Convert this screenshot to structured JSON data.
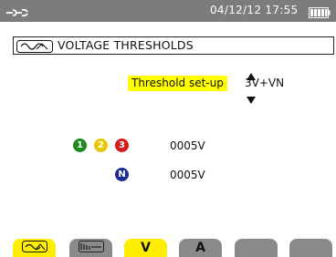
{
  "status_bar": {
    "datetime": "04/12/12 17:55",
    "icons": [
      "wrench-icon",
      "battery-icon"
    ]
  },
  "title": {
    "text": "VOLTAGE THRESHOLDS",
    "icon": "waveform-icon"
  },
  "threshold_setup": {
    "label": "Threshold set-up",
    "value": "3V+VN"
  },
  "phase_rows": [
    {
      "dots": [
        "1",
        "2",
        "3"
      ],
      "value": "0005V"
    },
    {
      "dots": [
        "N"
      ],
      "value": "0005V"
    }
  ],
  "colors": {
    "top_bar": "#7c7c7c",
    "highlight": "#ffff00",
    "phase1": "#1f8a1f",
    "phase2": "#e8c800",
    "phase3": "#d21b1b",
    "neutral": "#1b2f8f",
    "tab_active": "#ffee00",
    "tab_inactive": "#8a8a8a"
  },
  "tabs": [
    {
      "label": "",
      "icon": "waveform-icon",
      "active": true
    },
    {
      "label": "",
      "icon": "signal-icon",
      "active": false
    },
    {
      "label": "V",
      "icon": "",
      "active": true
    },
    {
      "label": "A",
      "icon": "",
      "active": false
    },
    {
      "label": "",
      "icon": "",
      "active": false
    },
    {
      "label": "",
      "icon": "",
      "active": false
    }
  ]
}
